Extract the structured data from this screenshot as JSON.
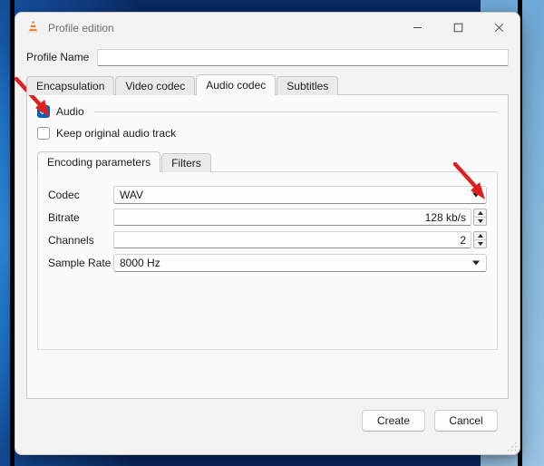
{
  "window": {
    "title": "Profile edition",
    "app_icon": "vlc-cone-icon",
    "controls": {
      "minimize": "minimize-icon",
      "maximize": "maximize-icon",
      "close": "close-icon"
    }
  },
  "profile": {
    "label": "Profile Name",
    "value": "",
    "placeholder": ""
  },
  "tabs": [
    {
      "label": "Encapsulation",
      "active": false
    },
    {
      "label": "Video codec",
      "active": false
    },
    {
      "label": "Audio codec",
      "active": true
    },
    {
      "label": "Subtitles",
      "active": false
    }
  ],
  "audio_section": {
    "audio_checkbox": {
      "label": "Audio",
      "checked": true
    },
    "keep_original_checkbox": {
      "label": "Keep original audio track",
      "checked": false
    }
  },
  "inner_tabs": [
    {
      "label": "Encoding parameters",
      "active": true
    },
    {
      "label": "Filters",
      "active": false
    }
  ],
  "encoding": {
    "codec": {
      "label": "Codec",
      "value": "WAV",
      "control": "combobox"
    },
    "bitrate": {
      "label": "Bitrate",
      "value": "128 kb/s",
      "control": "spinbox"
    },
    "channels": {
      "label": "Channels",
      "value": "2",
      "control": "spinbox"
    },
    "sample_rate": {
      "label": "Sample Rate",
      "value": "8000 Hz",
      "control": "combobox"
    }
  },
  "footer": {
    "create_label": "Create",
    "cancel_label": "Cancel"
  },
  "annotations": [
    {
      "name": "arrow-to-audio-checkbox",
      "color": "#e02020"
    },
    {
      "name": "arrow-to-codec-dropdown",
      "color": "#e02020"
    }
  ],
  "colors": {
    "accent": "#0b5fb8",
    "annotation": "#e02020",
    "window_bg": "#f3f3f3",
    "panel_bg": "#fbfbfb"
  }
}
